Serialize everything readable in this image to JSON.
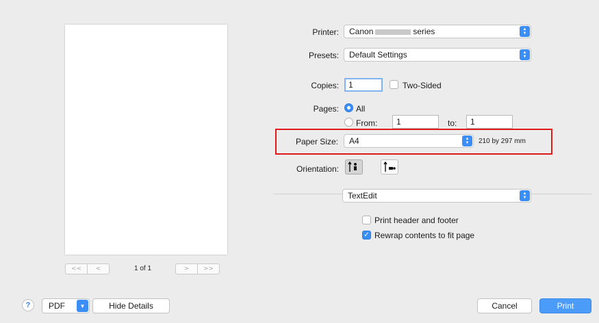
{
  "preview": {
    "page_first": "<<",
    "page_prev": "<",
    "page_indicator": "1 of 1",
    "page_next": ">",
    "page_last": ">>"
  },
  "printer": {
    "label": "Printer:",
    "value_prefix": "Canon",
    "value_suffix": "series"
  },
  "presets": {
    "label": "Presets:",
    "value": "Default Settings"
  },
  "copies": {
    "label": "Copies:",
    "value": "1",
    "two_sided_label": "Two-Sided"
  },
  "pages": {
    "label": "Pages:",
    "all_label": "All",
    "from_label": "From:",
    "from_value": "1",
    "to_label": "to:",
    "to_value": "1"
  },
  "paper_size": {
    "label": "Paper Size:",
    "value": "A4",
    "dimensions": "210 by 297 mm"
  },
  "orientation": {
    "label": "Orientation:"
  },
  "app_section": {
    "value": "TextEdit"
  },
  "options": {
    "header_footer_label": "Print header and footer",
    "rewrap_label": "Rewrap contents to fit page"
  },
  "footer": {
    "help_label": "?",
    "pdf_label": "PDF",
    "hide_details_label": "Hide Details",
    "cancel_label": "Cancel",
    "print_label": "Print"
  },
  "colors": {
    "accent": "#3a8ef6",
    "highlight": "#e0191b"
  }
}
